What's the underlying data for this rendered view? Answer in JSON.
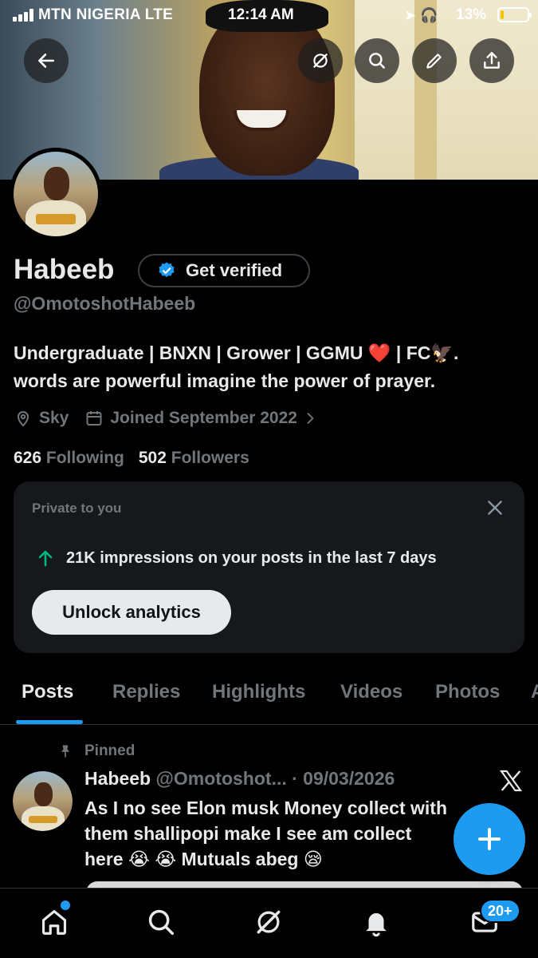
{
  "status_bar": {
    "carrier": "MTN NIGERIA  LTE",
    "time": "12:14 AM",
    "battery_percent": "13%",
    "battery_level": 0.13
  },
  "header": {
    "back_icon": "arrow-left-icon",
    "actions": [
      "grok-icon",
      "search-icon",
      "edit-icon",
      "share-icon"
    ]
  },
  "profile": {
    "name": "Habeeb",
    "verify_button": "Get verified",
    "handle": "@OmotoshotHabeeb",
    "bio_line1": "Undergraduate | BNXN | Grower | GGMU ❤️ | FC🦅.",
    "bio_line2": "words are powerful imagine the power of prayer.",
    "location": "Sky",
    "joined": "Joined September 2022",
    "following_count": "626",
    "following_label": "Following",
    "followers_count": "502",
    "followers_label": "Followers"
  },
  "analytics_card": {
    "label": "Private to you",
    "impressions_text": "21K impressions on your posts in the last 7 days",
    "button": "Unlock analytics"
  },
  "tabs": [
    "Posts",
    "Replies",
    "Highlights",
    "Videos",
    "Photos",
    "A"
  ],
  "active_tab": "Posts",
  "pinned_tweet": {
    "pinned_label": "Pinned",
    "name": "Habeeb",
    "handle_date": "@Omotoshot... · 09/03/2026",
    "text_line1": "As I no see Elon musk Money collect with",
    "text_line2": "them shallipopi make I see am collect",
    "text_line3": "here 😭 😭 Mutuals abeg 😪"
  },
  "bottom_nav": {
    "items": [
      "home-icon",
      "search-icon",
      "grok-icon",
      "notifications-icon",
      "messages-icon"
    ],
    "messages_badge": "20+"
  },
  "colors": {
    "accent": "#1d9bf0",
    "background": "#000000",
    "secondary_text": "#71767b",
    "card_bg": "#16181c",
    "trend_up": "#00ba7c"
  }
}
